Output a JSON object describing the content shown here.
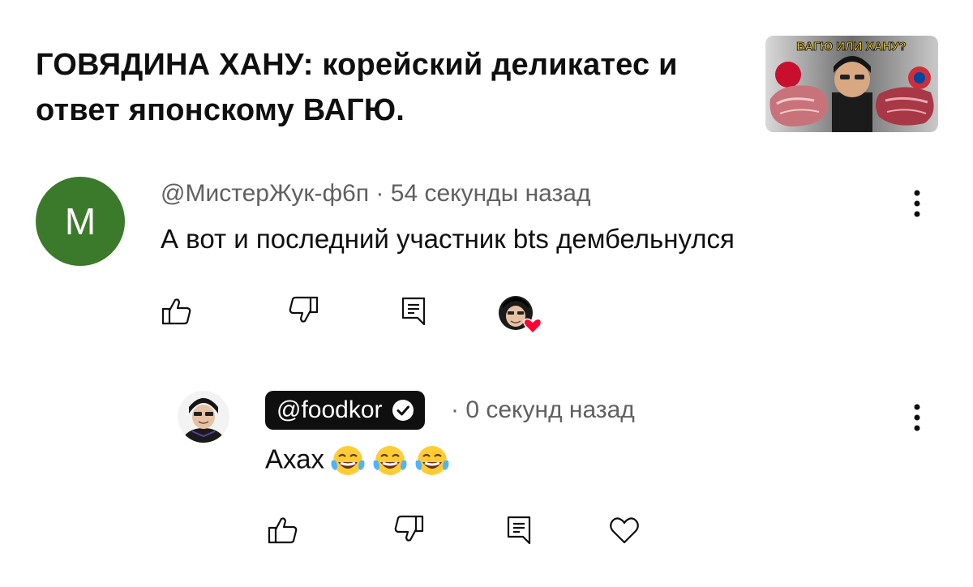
{
  "video": {
    "title": "ГОВЯДИНА ХАНУ: корейский деликатес и ответ японскому ВАГЮ.",
    "thumbnail_text": "ВАГЮ ИЛИ ХАНУ?"
  },
  "comment": {
    "avatar_letter": "M",
    "avatar_color": "#3b7a2a",
    "author": "@МистерЖук-ф6п",
    "separator": "·",
    "time": "54 секунды назад",
    "text": "А вот и последний участник bts дембельнулся"
  },
  "reply": {
    "author": "@foodkor",
    "verified_icon": "check-circle-icon",
    "separator": "·",
    "time": "0 секунд назад",
    "text": "Ахах",
    "emoji": [
      "face-with-tears-of-joy",
      "face-with-tears-of-joy",
      "face-with-tears-of-joy"
    ]
  },
  "icons": {
    "like": "thumb-up-icon",
    "dislike": "thumb-down-icon",
    "reply": "reply-comment-icon",
    "heart": "heart-outline-icon",
    "more": "more-vertical-icon"
  }
}
